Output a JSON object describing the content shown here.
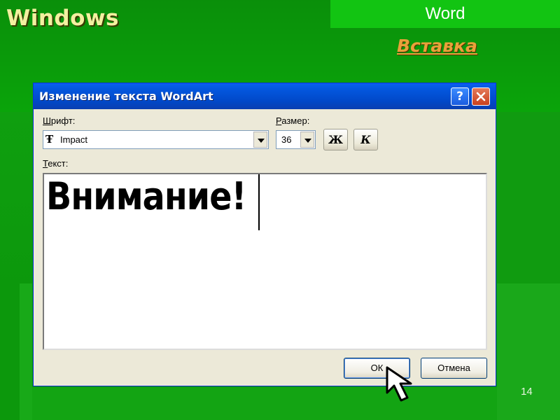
{
  "slide": {
    "title": "Windows",
    "app_label": "Word",
    "menu_link": "Вставка",
    "page_number": "14"
  },
  "dialog": {
    "title": "Изменение текста WordArt",
    "help_symbol": "?",
    "font_label_accel": "Ш",
    "font_label_rest": "рифт:",
    "font_value": "Impact",
    "size_label_accel": "Р",
    "size_label_rest": "азмер:",
    "size_value": "36",
    "bold_label": "Ж",
    "italic_label": "К",
    "text_label_accel": "Т",
    "text_label_rest": "екст:",
    "text_value": "Внимание!",
    "ok_label": "ОК",
    "cancel_label": "Отмена"
  },
  "colors": {
    "slide_bg": "#0b9a0b",
    "title_color": "#f3f0a0",
    "link_color": "#e8a13a",
    "titlebar": "#0148c8"
  },
  "icons": [
    "help-icon",
    "close-icon",
    "font-type-icon",
    "dropdown-arrow-icon",
    "mouse-pointer-icon"
  ]
}
